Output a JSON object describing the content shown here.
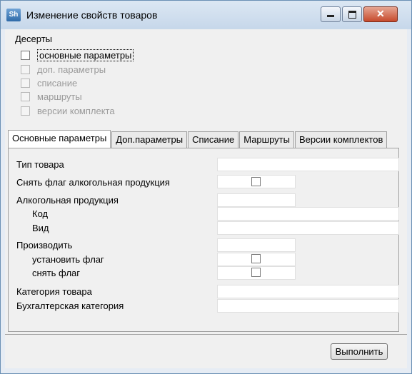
{
  "window": {
    "title": "Изменение свойств товаров",
    "icon_label": "Sh"
  },
  "group": {
    "label": "Десерты",
    "checkboxes": [
      {
        "label": "основные  параметры",
        "checked": false,
        "enabled": true
      },
      {
        "label": "доп. параметры",
        "checked": false,
        "enabled": false
      },
      {
        "label": "списание",
        "checked": false,
        "enabled": false
      },
      {
        "label": "маршруты",
        "checked": false,
        "enabled": false
      },
      {
        "label": "версии комплекта",
        "checked": false,
        "enabled": false
      }
    ]
  },
  "tabs": [
    {
      "label": "Основные параметры",
      "active": true
    },
    {
      "label": "Доп.параметры",
      "active": false
    },
    {
      "label": "Списание",
      "active": false
    },
    {
      "label": "Маршруты",
      "active": false
    },
    {
      "label": "Версии комплектов",
      "active": false
    }
  ],
  "form": {
    "product_type": {
      "label": "Тип товара",
      "value": ""
    },
    "remove_alcohol_flag": {
      "label": "Снять флаг алкогольная продукция",
      "checked": false
    },
    "alcohol": {
      "label": "Алкогольная продукция",
      "value": ""
    },
    "code": {
      "label": "Код",
      "value": ""
    },
    "kind": {
      "label": "Вид",
      "value": ""
    },
    "produce": {
      "label": "Производить",
      "value": ""
    },
    "set_flag": {
      "label": "установить флаг",
      "checked": false
    },
    "unset_flag": {
      "label": "снять флаг",
      "checked": false
    },
    "category": {
      "label": "Категория товара",
      "value": ""
    },
    "accounting_category": {
      "label": "Бухгалтерская категория",
      "value": ""
    }
  },
  "actions": {
    "execute_label": "Выполнить"
  }
}
